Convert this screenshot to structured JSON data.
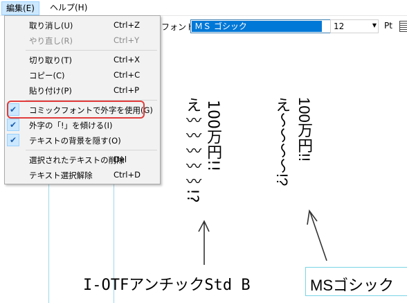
{
  "menubar": {
    "edit": "編集(E)",
    "help": "ヘルプ(H)"
  },
  "toolbar": {
    "font_label": "フォント:",
    "font_value": "ＭＳ ゴシック",
    "size_value": "12",
    "unit": "Pt"
  },
  "menu": {
    "undo": {
      "label": "取り消し(U)",
      "shortcut": "Ctrl+Z"
    },
    "redo": {
      "label": "やり直し(R)",
      "shortcut": "Ctrl+Y"
    },
    "cut": {
      "label": "切り取り(T)",
      "shortcut": "Ctrl+X"
    },
    "copy": {
      "label": "コピー(C)",
      "shortcut": "Ctrl+C"
    },
    "paste": {
      "label": "貼り付け(P)",
      "shortcut": "Ctrl+P"
    },
    "comic_font": {
      "label": "コミックフォントで外字を使用(G)",
      "checked": true
    },
    "tilt": {
      "label": "外字の「!」を傾ける(I)",
      "checked": true
    },
    "hide_bg": {
      "label": "テキストの背景を隠す(O)",
      "checked": true
    },
    "delete_sel": {
      "label": "選択されたテキストの削除",
      "shortcut": "Del"
    },
    "deselect": {
      "label": "テキスト選択解除",
      "shortcut": "Ctrl+D"
    }
  },
  "canvas": {
    "left_col1": "え〰〰〰〰〰!?",
    "left_col2": "100万円!!",
    "right_col1": "え〜〜〜〜!?",
    "right_col2": "100万円!!",
    "caption_left": "I-OTFアンチックStd B",
    "caption_right": "MSゴシック"
  },
  "colors": {
    "highlight": "#e23b3b",
    "menu_bg": "#f2f2f2",
    "selected_bg": "#0078d7",
    "guide": "#9fd8ea"
  }
}
